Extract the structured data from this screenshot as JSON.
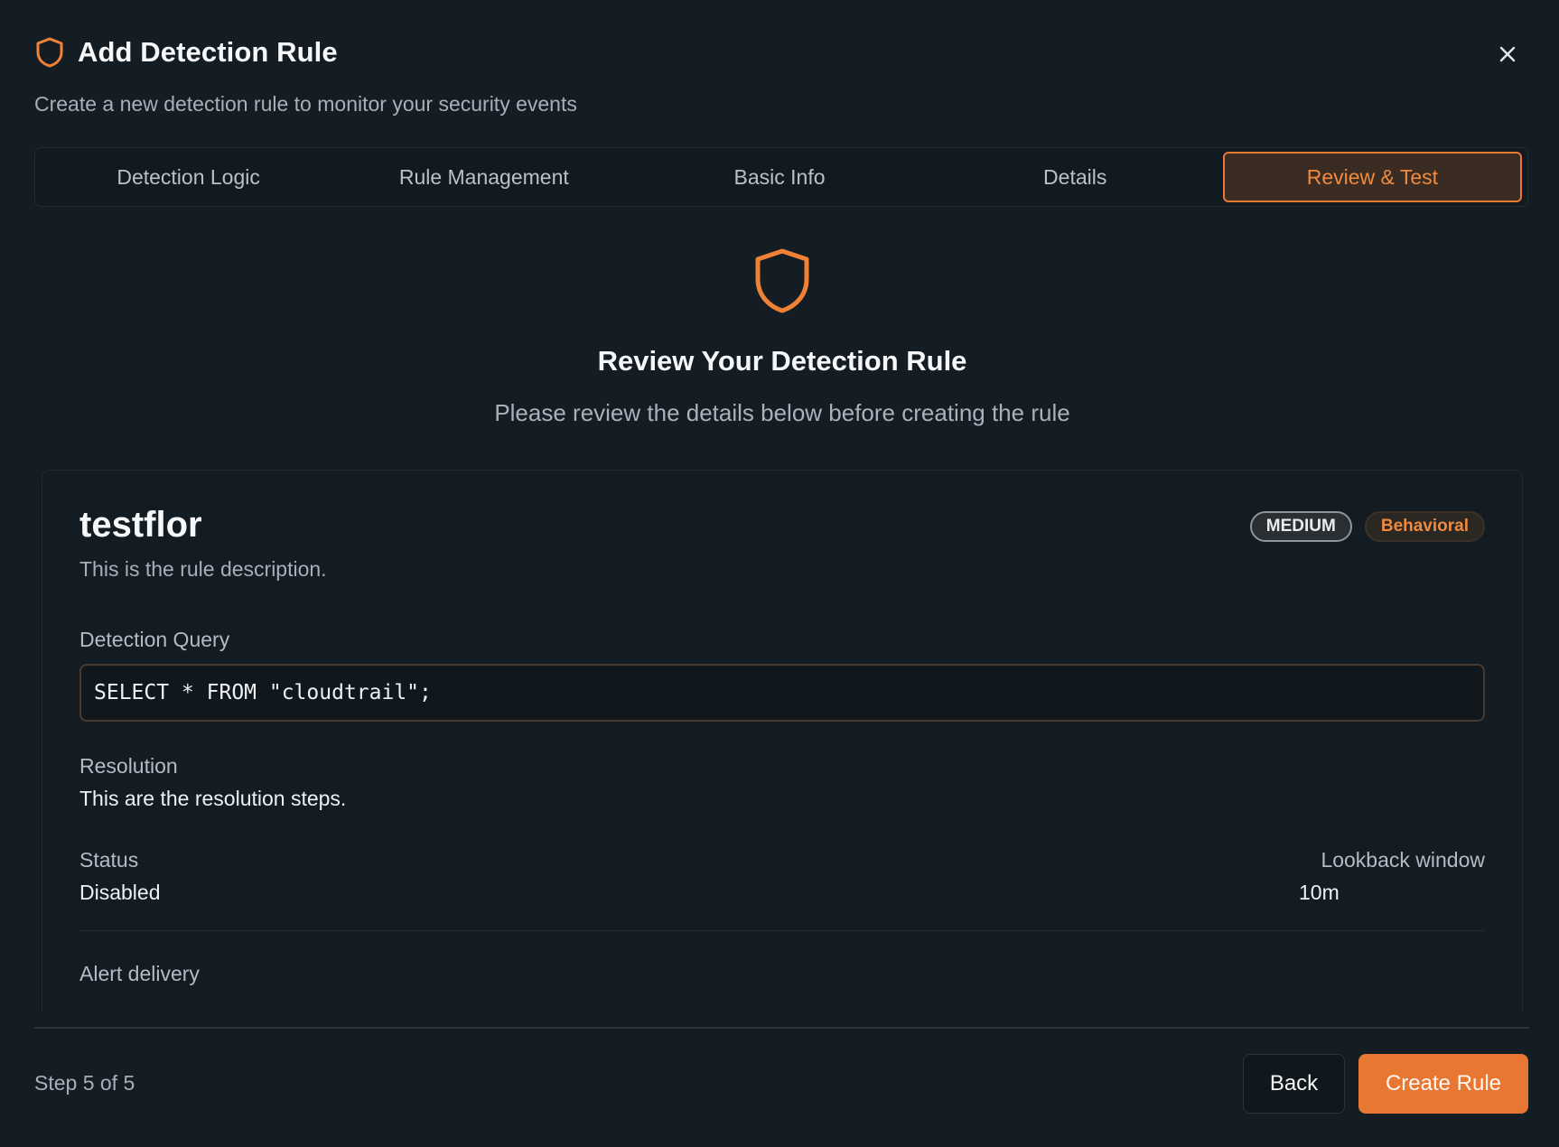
{
  "dialog": {
    "title": "Add Detection Rule",
    "subtitle": "Create a new detection rule to monitor your security events",
    "icon": "shield-icon",
    "close_icon": "close-icon"
  },
  "tabs": [
    {
      "label": "Detection Logic",
      "active": false
    },
    {
      "label": "Rule Management",
      "active": false
    },
    {
      "label": "Basic Info",
      "active": false
    },
    {
      "label": "Details",
      "active": false
    },
    {
      "label": "Review & Test",
      "active": true
    }
  ],
  "review": {
    "icon": "shield-icon",
    "title": "Review Your Detection Rule",
    "subtitle": "Please review the details below before creating the rule"
  },
  "rule": {
    "name": "testflor",
    "description": "This is the rule description.",
    "severity_badge": "MEDIUM",
    "type_badge": "Behavioral",
    "query_label": "Detection Query",
    "query": "SELECT * FROM \"cloudtrail\";",
    "resolution_label": "Resolution",
    "resolution": "This are the resolution steps.",
    "status_label": "Status",
    "status": "Disabled",
    "lookback_label": "Lookback window",
    "lookback": "10m",
    "alert_delivery_label": "Alert delivery"
  },
  "footer": {
    "step_text": "Step 5 of 5",
    "back_label": "Back",
    "create_label": "Create Rule"
  },
  "colors": {
    "background": "#141d24",
    "accent": "#e87733",
    "active_tab_bg": "#3a2c23"
  }
}
